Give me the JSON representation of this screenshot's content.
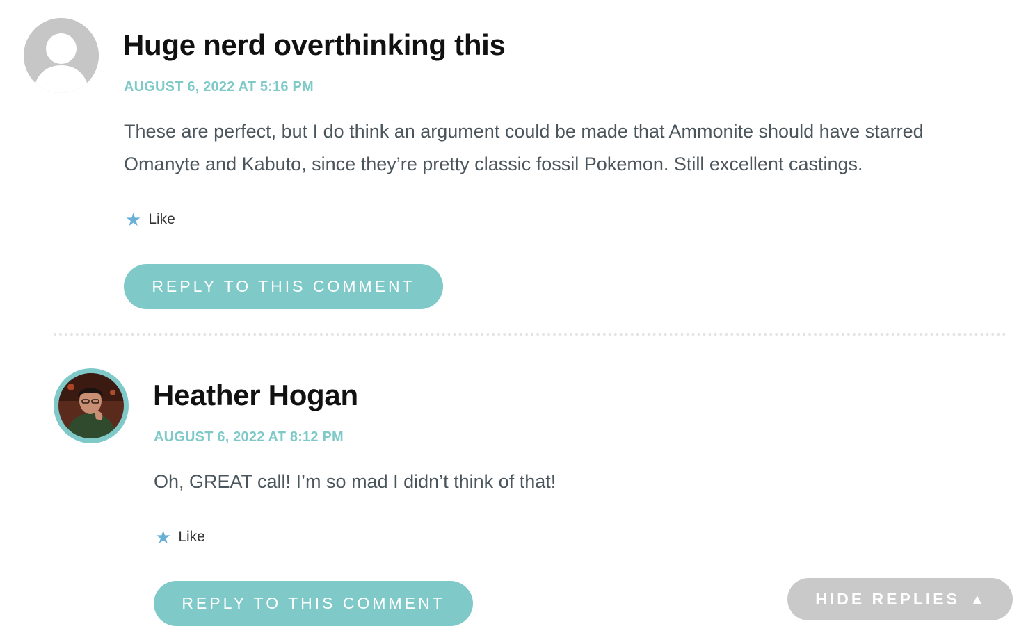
{
  "comments": [
    {
      "author": "Huge nerd overthinking this",
      "date": "AUGUST 6, 2022 AT 5:16 PM",
      "body_lines": [
        "These are perfect, but I do think an argument could be made that Ammonite should have starred",
        "Omanyte and Kabuto, since they’re pretty classic fossil Pokemon. Still excellent castings."
      ],
      "like_label": "Like",
      "reply_label": "REPLY TO THIS COMMENT",
      "avatar": "default-avatar-icon"
    },
    {
      "author": "Heather Hogan",
      "date": "AUGUST 6, 2022 AT 8:12 PM",
      "body_lines": [
        "Oh, GREAT call! I’m so mad I didn’t think of that!"
      ],
      "like_label": "Like",
      "reply_label": "REPLY TO THIS COMMENT",
      "avatar": "user-photo-avatar"
    }
  ],
  "hide_replies": {
    "label": "HIDE REPLIES",
    "icon": "triangle-up-icon",
    "glyph": "▲"
  },
  "icons": {
    "star_glyph": "★"
  },
  "colors": {
    "accent": "#7fcac9",
    "star": "#6aafd6",
    "text": "#4a555c",
    "author": "#111111",
    "hide_bg": "#c9c9c9"
  }
}
